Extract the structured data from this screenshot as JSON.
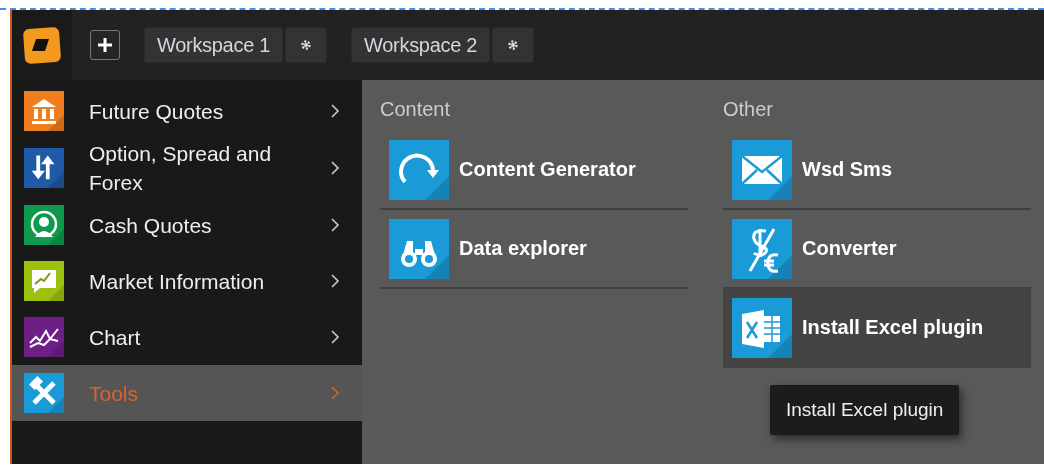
{
  "top_bar": {
    "workspaces": [
      {
        "label": "Workspace 1"
      },
      {
        "label": "Workspace 2"
      }
    ]
  },
  "menu": {
    "items": [
      {
        "label": "Future Quotes",
        "color": "#f07d1e",
        "selected": false
      },
      {
        "label": "Option, Spread and Forex",
        "color": "#1e5aa6",
        "selected": false
      },
      {
        "label": "Cash Quotes",
        "color": "#0e9a4e",
        "selected": false
      },
      {
        "label": "Market Information",
        "color": "#9cc20e",
        "selected": false
      },
      {
        "label": "Chart",
        "color": "#6e1f86",
        "selected": false
      },
      {
        "label": "Tools",
        "color": "#1a9ad6",
        "selected": true
      }
    ]
  },
  "panel": {
    "sections": [
      {
        "heading": "Content",
        "items": [
          {
            "label": "Content Generator",
            "hovered": false
          },
          {
            "label": "Data explorer",
            "hovered": false
          }
        ]
      },
      {
        "heading": "Other",
        "items": [
          {
            "label": "Wsd Sms",
            "hovered": false
          },
          {
            "label": "Converter",
            "hovered": false
          },
          {
            "label": "Install Excel plugin",
            "hovered": true
          }
        ]
      }
    ]
  },
  "tooltip": {
    "text": "Install Excel plugin"
  }
}
